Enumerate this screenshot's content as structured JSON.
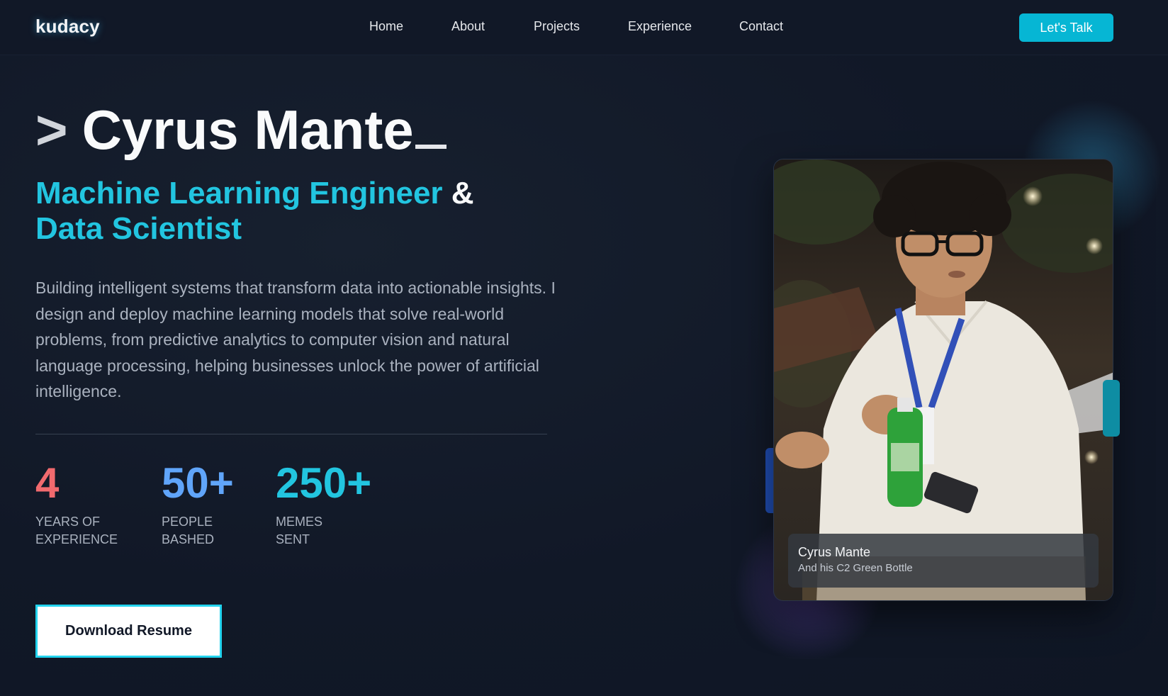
{
  "nav": {
    "logo": "kudacy",
    "links": [
      "Home",
      "About",
      "Projects",
      "Experience",
      "Contact"
    ],
    "cta_label": "Let's Talk"
  },
  "hero": {
    "prompt": ">",
    "name": "Cyrus Mante",
    "role_part1": "Machine Learning Engineer",
    "role_amp": "&",
    "role_part2": "Data Scientist",
    "bio": "Building intelligent systems that transform data into actionable insights. I design and deploy machine learning models that solve real-world problems, from predictive analytics to computer vision and natural language processing, helping businesses unlock the power of artificial intelligence.",
    "stats": [
      {
        "value": "4",
        "label_line1": "YEARS OF",
        "label_line2": "EXPERIENCE",
        "color": "#f16a6e"
      },
      {
        "value": "50+",
        "label_line1": "PEOPLE",
        "label_line2": "BASHED",
        "color": "#60a5fa"
      },
      {
        "value": "250+",
        "label_line1": "MEMES",
        "label_line2": "SENT",
        "color": "#22c5e0"
      }
    ],
    "download_label": "Download Resume"
  },
  "photo": {
    "caption_title": "Cyrus Mante",
    "caption_subtitle": "And his C2 Green Bottle"
  },
  "colors": {
    "accent": "#06b6d4",
    "background": "#111827",
    "stat_red": "#f16a6e",
    "stat_blue": "#60a5fa",
    "stat_cyan": "#22c5e0"
  }
}
